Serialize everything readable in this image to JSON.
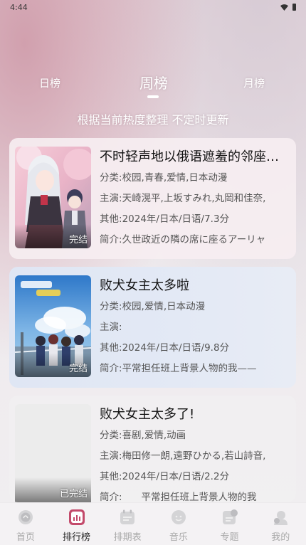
{
  "status_bar": {
    "time": "4:44",
    "icons": [
      "wifi-icon",
      "battery-icon"
    ]
  },
  "tabs": [
    {
      "label": "日榜",
      "active": false
    },
    {
      "label": "周榜",
      "active": true
    },
    {
      "label": "月榜",
      "active": false
    }
  ],
  "subtitle": "根据当前热度整理 不定时更新",
  "items": [
    {
      "title": "不时轻声地以俄语遮羞的邻座艾莉同学",
      "status": "完结",
      "category_label": "分类:",
      "category": "校园,青春,爱情,日本动漫",
      "cast_label": "主演:",
      "cast": "天崎滉平,上坂すみれ,丸岡和佳奈,",
      "other_label": "其他:",
      "other": "2024年/日本/日语/7.3分",
      "summary_label": "简介:",
      "summary": "久世政近の隣の席に座るアーリャ"
    },
    {
      "title": "败犬女主太多啦",
      "status": "完结",
      "category_label": "分类:",
      "category": "校园,爱情,日本动漫",
      "cast_label": "主演:",
      "cast": "",
      "other_label": "其他:",
      "other": "2024年/日本/日语/9.8分",
      "summary_label": "简介:",
      "summary": "平常担任班上背景人物的我——"
    },
    {
      "title": "败犬女主太多了!",
      "status": "已完结",
      "category_label": "分类:",
      "category": "喜剧,爱情,动画",
      "cast_label": "主演:",
      "cast": "梅田修一朗,遠野ひかる,若山詩音,",
      "other_label": "其他:",
      "other": "2024年/日本/日语/2.2分",
      "summary_label": "简介:",
      "summary": "　　平常担任班上背景人物的我"
    }
  ],
  "bottom_nav": [
    {
      "label": "首页",
      "icon": "home-icon",
      "active": false
    },
    {
      "label": "排行榜",
      "icon": "ranking-icon",
      "active": true
    },
    {
      "label": "排期表",
      "icon": "schedule-icon",
      "active": false
    },
    {
      "label": "音乐",
      "icon": "music-icon",
      "active": false
    },
    {
      "label": "专题",
      "icon": "topic-icon",
      "active": false
    },
    {
      "label": "我的",
      "icon": "profile-icon",
      "active": false
    }
  ],
  "colors": {
    "accent": "#c34a6b",
    "inactive": "#aaaaaa",
    "active": "#222222"
  }
}
